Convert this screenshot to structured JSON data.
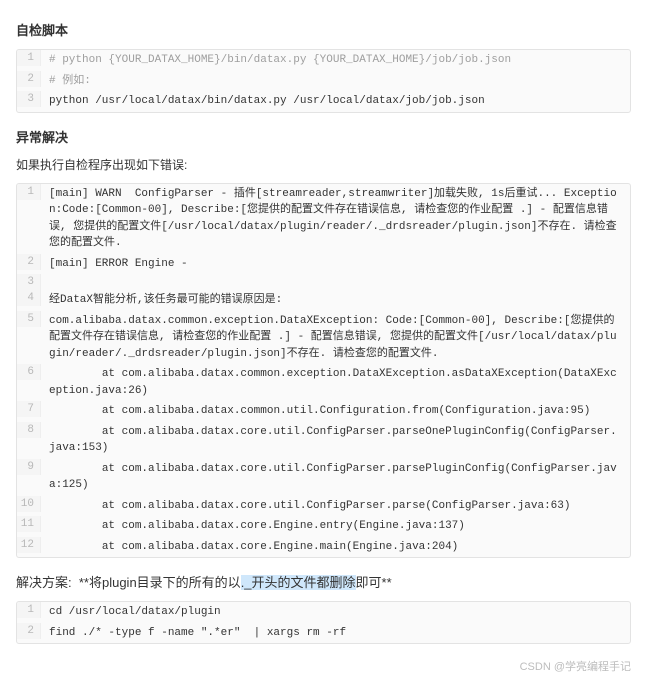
{
  "section1": {
    "title": "自检脚本",
    "code": [
      {
        "n": "1",
        "cls": "comment",
        "text": "# python {YOUR_DATAX_HOME}/bin/datax.py {YOUR_DATAX_HOME}/job/job.json"
      },
      {
        "n": "2",
        "cls": "comment",
        "text": "# 例如:"
      },
      {
        "n": "3",
        "cls": "",
        "text": "python /usr/local/datax/bin/datax.py /usr/local/datax/job/job.json"
      }
    ]
  },
  "section2": {
    "title": "异常解决",
    "desc": "如果执行自检程序出现如下错误:",
    "code": [
      {
        "n": "1",
        "cls": "",
        "text": "[main] WARN  ConfigParser - 插件[streamreader,streamwriter]加载失败, 1s后重试... Exception:Code:[Common-00], Describe:[您提供的配置文件存在错误信息, 请检查您的作业配置 .] - 配置信息错误, 您提供的配置文件[/usr/local/datax/plugin/reader/._drdsreader/plugin.json]不存在. 请检查您的配置文件."
      },
      {
        "n": "2",
        "cls": "",
        "text": "[main] ERROR Engine -"
      },
      {
        "n": "3",
        "cls": "",
        "text": ""
      },
      {
        "n": "4",
        "cls": "",
        "text": "经DataX智能分析,该任务最可能的错误原因是:"
      },
      {
        "n": "5",
        "cls": "",
        "text": "com.alibaba.datax.common.exception.DataXException: Code:[Common-00], Describe:[您提供的配置文件存在错误信息, 请检查您的作业配置 .] - 配置信息错误, 您提供的配置文件[/usr/local/datax/plugin/reader/._drdsreader/plugin.json]不存在. 请检查您的配置文件."
      },
      {
        "n": "6",
        "cls": "",
        "text": "        at com.alibaba.datax.common.exception.DataXException.asDataXException(DataXException.java:26)"
      },
      {
        "n": "7",
        "cls": "",
        "text": "        at com.alibaba.datax.common.util.Configuration.from(Configuration.java:95)"
      },
      {
        "n": "8",
        "cls": "",
        "text": "        at com.alibaba.datax.core.util.ConfigParser.parseOnePluginConfig(ConfigParser.java:153)"
      },
      {
        "n": "9",
        "cls": "",
        "text": "        at com.alibaba.datax.core.util.ConfigParser.parsePluginConfig(ConfigParser.java:125)"
      },
      {
        "n": "10",
        "cls": "",
        "text": "        at com.alibaba.datax.core.util.ConfigParser.parse(ConfigParser.java:63)"
      },
      {
        "n": "11",
        "cls": "",
        "text": "        at com.alibaba.datax.core.Engine.entry(Engine.java:137)"
      },
      {
        "n": "12",
        "cls": "",
        "text": "        at com.alibaba.datax.core.Engine.main(Engine.java:204)"
      }
    ]
  },
  "solution": {
    "label": "解决方案:",
    "pre": "**将plugin目录下的所有的以",
    "hl": "._开头的文件都删除",
    "post": "即可**"
  },
  "section3": {
    "code": [
      {
        "n": "1",
        "cls": "",
        "text": "cd /usr/local/datax/plugin"
      },
      {
        "n": "2",
        "cls": "",
        "text": "find ./* -type f -name \".*er\"  | xargs rm -rf"
      }
    ]
  },
  "watermark": "CSDN @学亮编程手记"
}
